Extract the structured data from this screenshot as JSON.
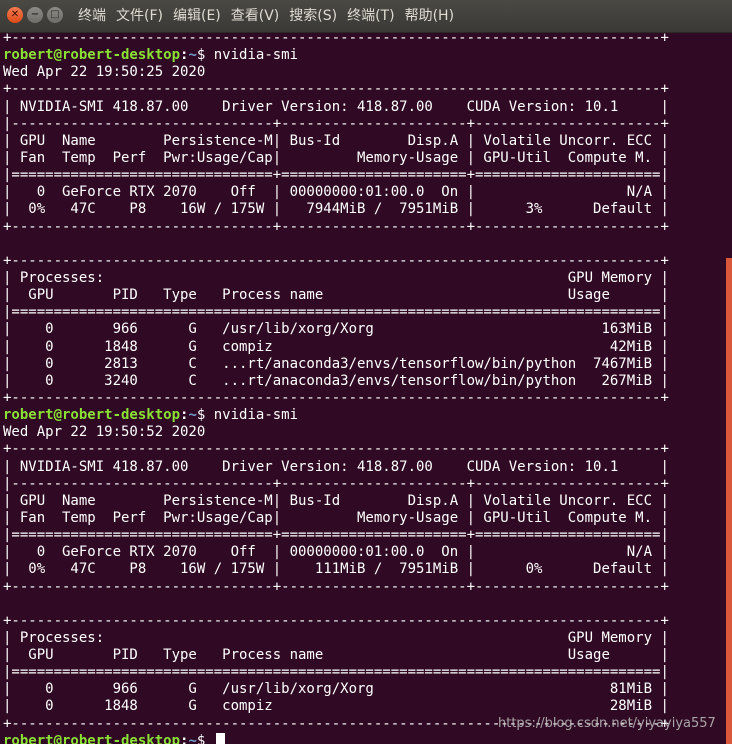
{
  "window": {
    "buttons": {
      "close": "✕",
      "minimize": "−",
      "maximize": "□"
    },
    "menu": [
      "终端",
      "文件(F)",
      "编辑(E)",
      "查看(V)",
      "搜索(S)",
      "终端(T)",
      "帮助(H)"
    ]
  },
  "colors": {
    "background": "#300a24",
    "prompt_user": "#8ae234",
    "prompt_path": "#729fcf",
    "scrollbar": "#d9583b"
  },
  "terminal": {
    "lines": [
      {
        "type": "text",
        "text": "+-----------------------------------------------------------------------------+"
      },
      {
        "type": "prompt",
        "user": "robert@robert-desktop",
        "sep": ":",
        "path": "~",
        "sym": "$ ",
        "cmd": "nvidia-smi"
      },
      {
        "type": "text",
        "text": "Wed Apr 22 19:50:25 2020"
      },
      {
        "type": "text",
        "text": "+-----------------------------------------------------------------------------+"
      },
      {
        "type": "text",
        "text": "| NVIDIA-SMI 418.87.00    Driver Version: 418.87.00    CUDA Version: 10.1     |"
      },
      {
        "type": "text",
        "text": "|-------------------------------+----------------------+----------------------+"
      },
      {
        "type": "text",
        "text": "| GPU  Name        Persistence-M| Bus-Id        Disp.A | Volatile Uncorr. ECC |"
      },
      {
        "type": "text",
        "text": "| Fan  Temp  Perf  Pwr:Usage/Cap|         Memory-Usage | GPU-Util  Compute M. |"
      },
      {
        "type": "text",
        "text": "|===============================+======================+======================|"
      },
      {
        "type": "text",
        "text": "|   0  GeForce RTX 2070    Off  | 00000000:01:00.0  On |                  N/A |"
      },
      {
        "type": "text",
        "text": "|  0%   47C    P8    16W / 175W |   7944MiB /  7951MiB |      3%      Default |"
      },
      {
        "type": "text",
        "text": "+-------------------------------+----------------------+----------------------+"
      },
      {
        "type": "text",
        "text": ""
      },
      {
        "type": "text",
        "text": "+-----------------------------------------------------------------------------+"
      },
      {
        "type": "text",
        "text": "| Processes:                                                       GPU Memory |"
      },
      {
        "type": "text",
        "text": "|  GPU       PID   Type   Process name                             Usage      |"
      },
      {
        "type": "text",
        "text": "|=============================================================================|"
      },
      {
        "type": "text",
        "text": "|    0       966      G   /usr/lib/xorg/Xorg                           163MiB |"
      },
      {
        "type": "text",
        "text": "|    0      1848      G   compiz                                        42MiB |"
      },
      {
        "type": "text",
        "text": "|    0      2813      C   ...rt/anaconda3/envs/tensorflow/bin/python  7467MiB |"
      },
      {
        "type": "text",
        "text": "|    0      3240      C   ...rt/anaconda3/envs/tensorflow/bin/python   267MiB |"
      },
      {
        "type": "text",
        "text": "+-----------------------------------------------------------------------------+"
      },
      {
        "type": "prompt",
        "user": "robert@robert-desktop",
        "sep": ":",
        "path": "~",
        "sym": "$ ",
        "cmd": "nvidia-smi"
      },
      {
        "type": "text",
        "text": "Wed Apr 22 19:50:52 2020"
      },
      {
        "type": "text",
        "text": "+-----------------------------------------------------------------------------+"
      },
      {
        "type": "text",
        "text": "| NVIDIA-SMI 418.87.00    Driver Version: 418.87.00    CUDA Version: 10.1     |"
      },
      {
        "type": "text",
        "text": "|-------------------------------+----------------------+----------------------+"
      },
      {
        "type": "text",
        "text": "| GPU  Name        Persistence-M| Bus-Id        Disp.A | Volatile Uncorr. ECC |"
      },
      {
        "type": "text",
        "text": "| Fan  Temp  Perf  Pwr:Usage/Cap|         Memory-Usage | GPU-Util  Compute M. |"
      },
      {
        "type": "text",
        "text": "|===============================+======================+======================|"
      },
      {
        "type": "text",
        "text": "|   0  GeForce RTX 2070    Off  | 00000000:01:00.0  On |                  N/A |"
      },
      {
        "type": "text",
        "text": "|  0%   47C    P8    16W / 175W |    111MiB /  7951MiB |      0%      Default |"
      },
      {
        "type": "text",
        "text": "+-------------------------------+----------------------+----------------------+"
      },
      {
        "type": "text",
        "text": ""
      },
      {
        "type": "text",
        "text": "+-----------------------------------------------------------------------------+"
      },
      {
        "type": "text",
        "text": "| Processes:                                                       GPU Memory |"
      },
      {
        "type": "text",
        "text": "|  GPU       PID   Type   Process name                             Usage      |"
      },
      {
        "type": "text",
        "text": "|=============================================================================|"
      },
      {
        "type": "text",
        "text": "|    0       966      G   /usr/lib/xorg/Xorg                            81MiB |"
      },
      {
        "type": "text",
        "text": "|    0      1848      G   compiz                                        28MiB |"
      },
      {
        "type": "text",
        "text": "+-----------------------------------------------------------------------------+"
      },
      {
        "type": "prompt",
        "user": "robert@robert-desktop",
        "sep": ":",
        "path": "~",
        "sym": "$ ",
        "cmd": "",
        "cursor": true
      }
    ]
  },
  "watermark": "https://blog.csdn.net/yiyayiya557"
}
